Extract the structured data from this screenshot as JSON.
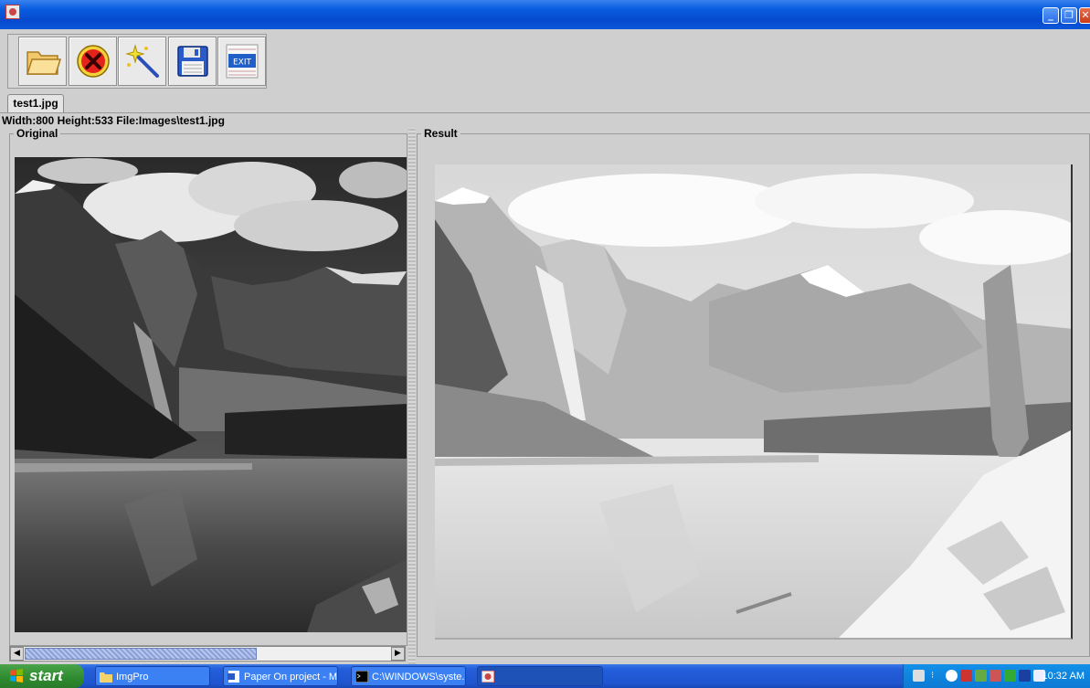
{
  "window": {
    "title": "",
    "controls": [
      "minimize",
      "restore",
      "close"
    ]
  },
  "toolbar": {
    "buttons": [
      {
        "name": "open",
        "icon": "folder-icon"
      },
      {
        "name": "clear",
        "icon": "red-x-icon"
      },
      {
        "name": "process",
        "icon": "magic-wand-icon"
      },
      {
        "name": "save",
        "icon": "floppy-disk-icon"
      },
      {
        "name": "exit",
        "icon": "exit-icon",
        "label": "EXIT"
      }
    ]
  },
  "file_tab": {
    "label": "test1.jpg"
  },
  "info": {
    "text": "Width:800  Height:533 File:Images\\test1.jpg"
  },
  "panels": {
    "original": {
      "title": "Original"
    },
    "result": {
      "title": "Result"
    }
  },
  "taskbar": {
    "start_label": "start",
    "tasks": [
      {
        "label": "ImgPro",
        "icon": "folder-icon"
      },
      {
        "label": "Paper On project - Mi...",
        "icon": "word-doc-icon"
      },
      {
        "label": "C:\\WINDOWS\\syste...",
        "icon": "console-icon"
      },
      {
        "label": "",
        "icon": "java-app-icon",
        "active": true
      }
    ],
    "clock": "10:32 AM"
  },
  "colors": {
    "titlebar": "#0a5ee0",
    "taskbar": "#245edb",
    "start_button": "#2e8a2e",
    "window_bg": "#cfcfcf"
  }
}
